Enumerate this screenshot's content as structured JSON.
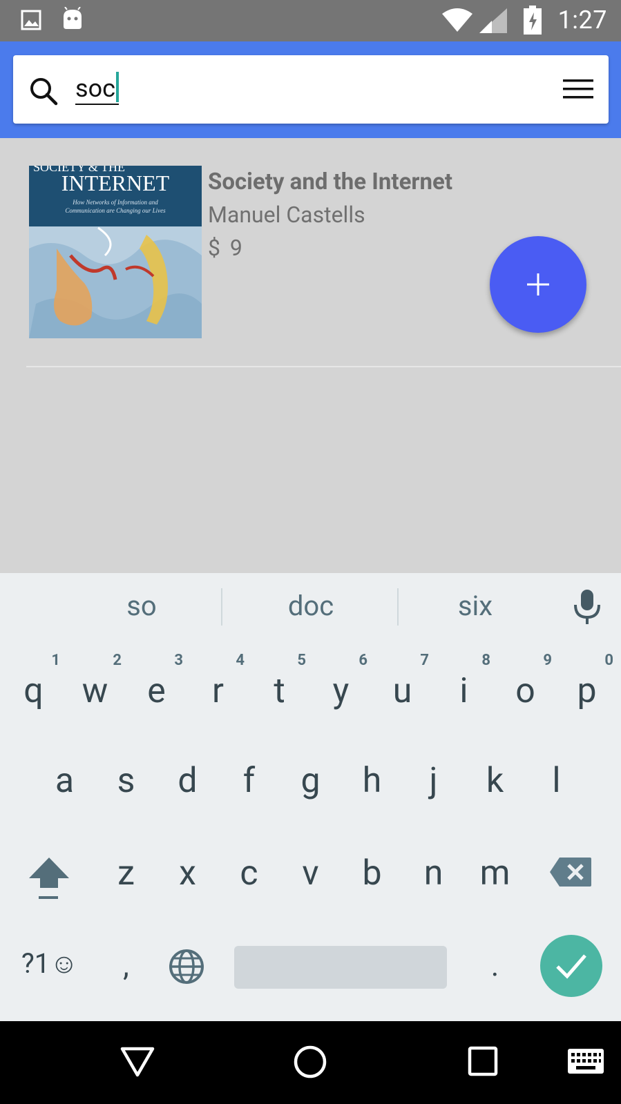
{
  "status_bar": {
    "time": "1:27",
    "icons": [
      "image-icon",
      "android-icon",
      "wifi-icon",
      "signal-icon",
      "battery-charging-icon"
    ]
  },
  "search": {
    "query": "soc",
    "icon": "search-icon",
    "menu_icon": "menu-icon"
  },
  "results": [
    {
      "title": "Society and the Internet",
      "author": "Manuel Castells",
      "price": "$ 9",
      "cover_text": "INTERNET",
      "cover_subtitle": "How Networks of Information and Communication are Changing our Lives"
    }
  ],
  "fab": {
    "icon": "plus-icon"
  },
  "keyboard": {
    "suggestions": [
      "so",
      "doc",
      "six"
    ],
    "row1": [
      "q",
      "w",
      "e",
      "r",
      "t",
      "y",
      "u",
      "i",
      "o",
      "p"
    ],
    "row1_hints": [
      "1",
      "2",
      "3",
      "4",
      "5",
      "6",
      "7",
      "8",
      "9",
      "0"
    ],
    "row2": [
      "a",
      "s",
      "d",
      "f",
      "g",
      "h",
      "j",
      "k",
      "l"
    ],
    "row3": [
      "z",
      "x",
      "c",
      "v",
      "b",
      "n",
      "m"
    ],
    "symbols_key": "?1☺",
    "comma_key": ",",
    "period_key": "."
  },
  "nav": {
    "icons": [
      "back-icon",
      "home-icon",
      "recents-icon",
      "keyboard-icon"
    ]
  },
  "colors": {
    "app_bar": "#4b7bec",
    "fab": "#4a5cf3",
    "enter_key": "#4cb6a3",
    "status_bar": "#757575"
  }
}
